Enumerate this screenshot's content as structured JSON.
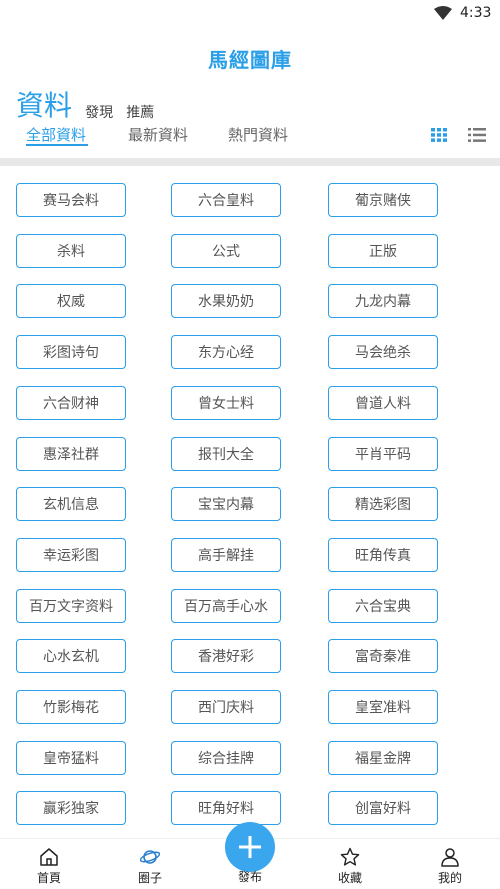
{
  "status_bar": {
    "time": "4:33",
    "wifi_icon": "wifi-icon"
  },
  "app": {
    "title": "馬經圖庫"
  },
  "section": {
    "title": "資料",
    "links": [
      "發現",
      "推薦"
    ]
  },
  "tabs": [
    "全部資料",
    "最新資料",
    "熱門資料"
  ],
  "active_tab": "全部資料",
  "view_toggle": {
    "grid_icon": "grid-view-icon",
    "list_icon": "list-view-icon",
    "selected": "grid"
  },
  "accent_color": "#2a9fe8",
  "items": [
    "赛马会料",
    "六合皇料",
    "葡京赌侠",
    "杀料",
    "公式",
    "正版",
    "权威",
    "水果奶奶",
    "九龙内幕",
    "彩图诗句",
    "东方心经",
    "马会绝杀",
    "六合财神",
    "曾女士料",
    "曾道人料",
    "惠泽社群",
    "报刊大全",
    "平肖平码",
    "玄机信息",
    "宝宝内幕",
    "精选彩图",
    "幸运彩图",
    "高手解挂",
    "旺角传真",
    "百万文字资料",
    "百万高手心水",
    "六合宝典",
    "心水玄机",
    "香港好彩",
    "富奇秦准",
    "竹影梅花",
    "西门庆料",
    "皇室准料",
    "皇帝猛料",
    "综合挂牌",
    "福星金牌",
    "赢彩独家",
    "旺角好料",
    "创富好料"
  ],
  "bottom_nav": {
    "home": {
      "label": "首頁",
      "icon": "home-icon"
    },
    "circle": {
      "label": "圈子",
      "icon": "planet-icon"
    },
    "publish": {
      "label": "發布",
      "icon": "plus-icon"
    },
    "favorites": {
      "label": "收藏",
      "icon": "star-icon"
    },
    "mine": {
      "label": "我的",
      "icon": "user-icon"
    }
  }
}
